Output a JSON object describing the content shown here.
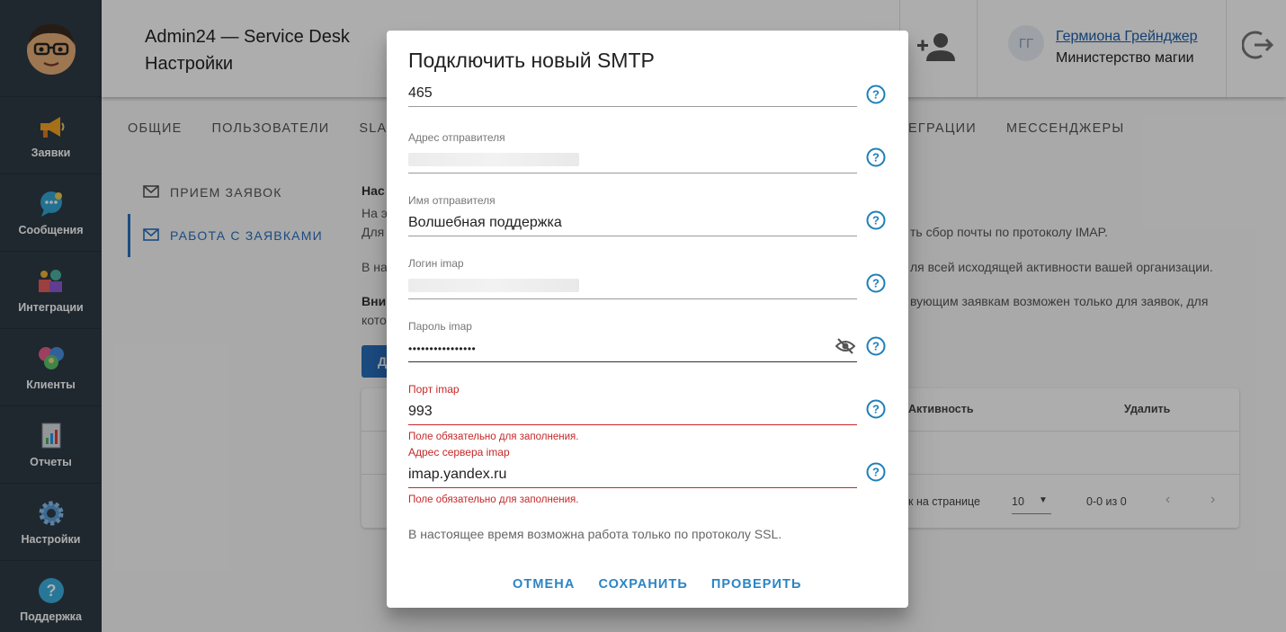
{
  "sidebar": {
    "items": [
      {
        "label": "Заявки",
        "icon": "megaphone-icon"
      },
      {
        "label": "Сообщения",
        "icon": "chat-bubble-icon"
      },
      {
        "label": "Интеграции",
        "icon": "puzzle-gears-icon"
      },
      {
        "label": "Клиенты",
        "icon": "hearts-people-icon"
      },
      {
        "label": "Отчеты",
        "icon": "report-chart-icon"
      },
      {
        "label": "Настройки",
        "icon": "gear-icon"
      },
      {
        "label": "Поддержка",
        "icon": "help-circle-icon"
      }
    ]
  },
  "header": {
    "app_title": "Admin24 — Service Desk",
    "page_title": "Настройки",
    "user_initials": "ГГ",
    "user_name": "Гермиона Грейнджер",
    "user_org": "Министерство магии"
  },
  "tabs": {
    "general": "ОБЩИЕ",
    "users": "ПОЛЬЗОВАТЕЛИ",
    "sla": "SLA",
    "integrations": "ТЕГРАЦИИ",
    "messengers": "МЕССЕНДЖЕРЫ"
  },
  "subnav": {
    "intake": "ПРИЕМ ЗАЯВОК",
    "work": "РАБОТА С ЗАЯВКАМИ"
  },
  "background": {
    "heading": "Нас",
    "line1a": "На э",
    "line1b": "Для",
    "line1c": "ть сбор почты по протоколу IMAP.",
    "line2a": "В на",
    "line2b": "ля всей исходящей активности вашей организации.",
    "line3a": "Вни",
    "line3b": "вующим заявкам возможен только для заявок, для",
    "line3c": "кото",
    "button_label": "Д",
    "table_activity": "Активность",
    "table_delete": "Удалить",
    "per_page_label": "к на странице",
    "per_page_value": "10",
    "range": "0-0 из 0"
  },
  "dialog": {
    "title": "Подключить новый SMTP",
    "smtp_port_value": "465",
    "sender_address_label": "Адрес отправителя",
    "sender_name_label": "Имя отправителя",
    "sender_name_value": "Волшебная поддержка",
    "imap_login_label": "Логин imap",
    "imap_password_label": "Пароль imap",
    "imap_password_value": "••••••••••••••••",
    "imap_port_label": "Порт imap",
    "imap_port_value": "993",
    "imap_port_error": "Поле обязательно для заполнения.",
    "imap_server_label": "Адрес сервера imap",
    "imap_server_value": "imap.yandex.ru",
    "imap_server_error": "Поле обязательно для заполнения.",
    "note": "В настоящее время возможна работа только по протоколу SSL.",
    "cancel": "ОТМЕНА",
    "save": "СОХРАНИТЬ",
    "check": "ПРОВЕРИТЬ"
  },
  "colors": {
    "sidebar_bg": "#2f3b46",
    "accent": "#2a6fbf",
    "action_text": "#2b84c4",
    "error": "#c62828",
    "help_icon": "#1e7fb8"
  }
}
